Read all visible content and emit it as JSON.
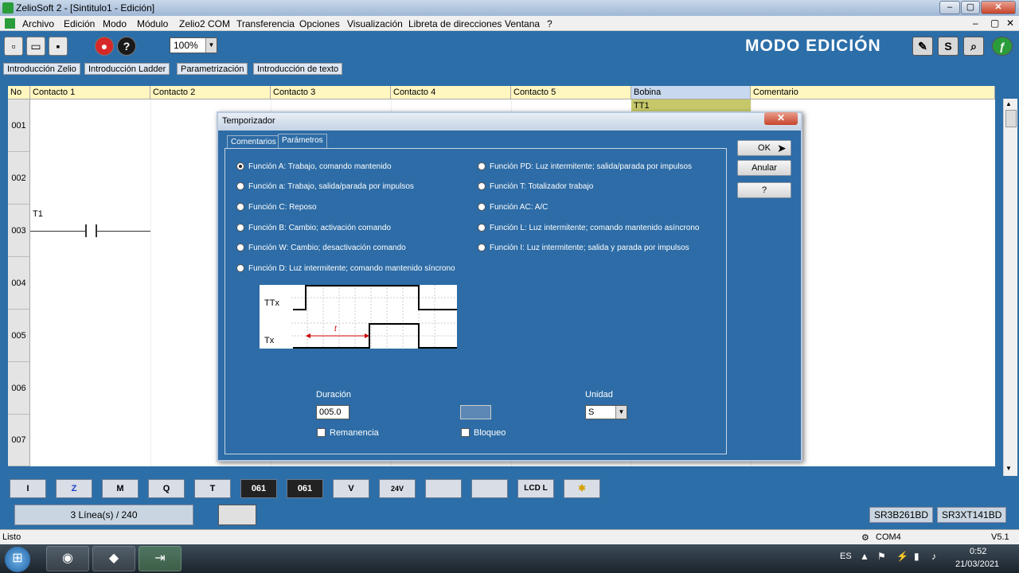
{
  "window": {
    "title": "ZelioSoft 2 - [Sintitulo1 - Edición]",
    "min": "–",
    "max": "▢",
    "close": "✕",
    "inner_min": "–",
    "inner_max": "▢",
    "inner_close": "✕"
  },
  "menu": [
    "Archivo",
    "Edición",
    "Modo",
    "Módulo",
    "Zelio2 COM",
    "Transferencia",
    "Opciones",
    "Visualización",
    "Libreta de direcciones",
    "Ventana",
    "?"
  ],
  "toolbar": {
    "zoom": "100%",
    "mode": "MODO EDICIÓN",
    "s_label": "S",
    "help_label": "?"
  },
  "tabs": [
    "Introducción Zelio",
    "Introducción Ladder",
    "Parametrización",
    "Introducción de texto"
  ],
  "grid": {
    "headers": [
      "No",
      "Contacto 1",
      "Contacto 2",
      "Contacto 3",
      "Contacto 4",
      "Contacto 5",
      "Bobina",
      "Comentario"
    ],
    "rows": [
      "001",
      "002",
      "003",
      "004",
      "005",
      "006",
      "007"
    ],
    "contact_label": "T1",
    "coil_label": "TT1",
    "coil_symbol": "( )"
  },
  "dialog": {
    "title": "Temporizador",
    "close": "✕",
    "tabs": [
      "Comentarios",
      "Parámetros"
    ],
    "left_options": [
      "Función A: Trabajo, comando mantenido",
      "Función a: Trabajo, salida/parada por impulsos",
      "Función C: Reposo",
      "Función B: Cambio; activación comando",
      "Función W: Cambio; desactivación comando",
      "Función D: Luz intermitente; comando mantenido síncrono"
    ],
    "right_options": [
      "Función PD: Luz intermitente; salida/parada por impulsos",
      "Función T: Totalizador trabajo",
      "Función AC: A/C",
      "Función L: Luz intermitente; comando mantenido asíncrono",
      "Función I: Luz intermitente; salida y parada por impulsos"
    ],
    "selected": 0,
    "buttons": {
      "ok": "OK",
      "cancel": "Anular",
      "help": "?"
    },
    "diagram": {
      "ttx": "TTx",
      "tx": "Tx",
      "t": "t"
    },
    "duration_label": "Duración",
    "duration_value": "005.0",
    "unit_label": "Unidad",
    "unit_value": "S",
    "remanence_label": "Remanencia",
    "lock_label": "Bloqueo"
  },
  "bottom_tools": [
    "I",
    "Z",
    "M",
    "Q",
    "T",
    "061",
    "061",
    "V",
    "24V",
    "",
    "",
    "LCD L",
    "✱"
  ],
  "status": {
    "lines": "3 Línea(s) / 240",
    "ref1": "SR3B261BD",
    "ref2": "SR3XT141BD",
    "ready": "Listo",
    "port": "COM4",
    "version": "V5.1"
  },
  "taskbar": {
    "lang": "ES",
    "time": "0:52",
    "date": "21/03/2021"
  },
  "colors": {
    "bg": "#2c6ea8",
    "header": "#fff6c0",
    "coil": "#c8d8ee"
  }
}
